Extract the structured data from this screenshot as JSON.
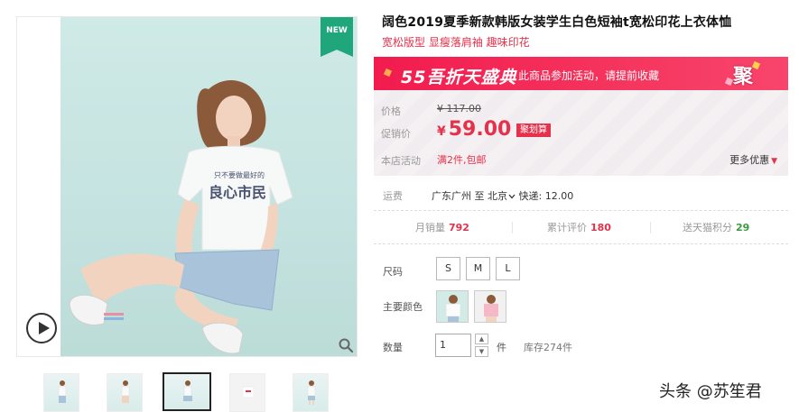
{
  "gallery": {
    "badge": "NEW",
    "thumbnails": [
      {
        "name": "thumbnail-1",
        "active": false
      },
      {
        "name": "thumbnail-2",
        "active": false
      },
      {
        "name": "thumbnail-3",
        "active": true
      },
      {
        "name": "thumbnail-4",
        "active": false
      },
      {
        "name": "thumbnail-5",
        "active": false
      }
    ],
    "shirt_text": {
      "line1": "只不要做最好的",
      "line2": "良心市民"
    }
  },
  "product": {
    "title": "阔色2019夏季新款韩版女装学生白色短袖t宽松印花上衣体恤",
    "subtitle": "宽松版型  显瘦落肩袖  趣味印花"
  },
  "promo_banner": {
    "logo": "55吾折天盛典",
    "text": "此商品参加活动，请提前收藏",
    "badge": "聚"
  },
  "pricing": {
    "original_label": "价格",
    "original_price": "¥ 117.00",
    "promo_label": "促销价",
    "currency": "¥",
    "promo_price": "59.00",
    "promo_tag": "聚划算",
    "activity_label": "本店活动",
    "activity_value": "满2件,包邮",
    "more_offers": "更多优惠",
    "more_offers_caret": "▼"
  },
  "shipping": {
    "label": "运费",
    "origin": "广东广州",
    "to": "至",
    "destination": "北京",
    "method": "快递: 12.00"
  },
  "stats": {
    "monthly_sales_label": "月销量",
    "monthly_sales_value": "792",
    "reviews_label": "累计评价",
    "reviews_value": "180",
    "points_label": "送天猫积分",
    "points_value": "29"
  },
  "options": {
    "size_label": "尺码",
    "sizes": [
      "S",
      "M",
      "L"
    ],
    "color_label": "主要颜色",
    "quantity_label": "数量",
    "quantity_value": "1",
    "quantity_unit": "件",
    "stock": "库存274件"
  },
  "watermark": "头条 @苏笙君",
  "colors": {
    "accent_red": "#e5314b",
    "badge_green": "#1fa67a",
    "banner_red": "#f21b4e",
    "points_green": "#3d9a3d"
  }
}
